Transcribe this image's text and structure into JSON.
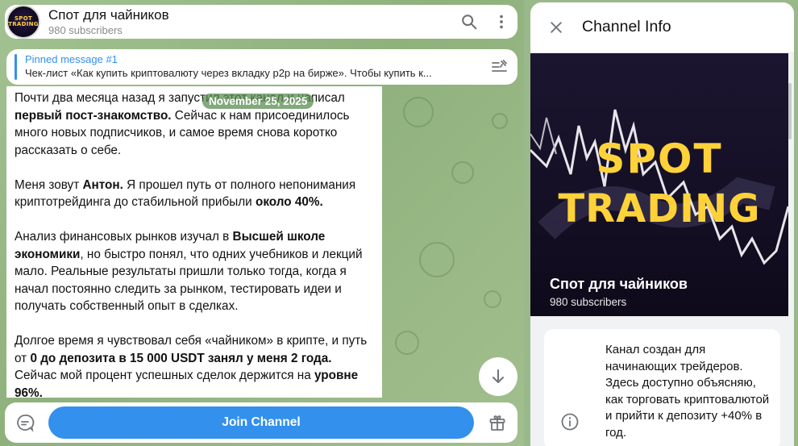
{
  "header": {
    "avatar_text": [
      "SPOT",
      "TRADING"
    ],
    "title": "Спот для чайников",
    "subtitle": "980 subscribers"
  },
  "pinned": {
    "title": "Pinned message #1",
    "text": "Чек-лист «Как купить криптовалюту через вкладку p2p на бирже».  Чтобы купить к..."
  },
  "date_pill": "November 25, 2025",
  "message": {
    "p1": [
      {
        "t": "Почти два месяца назад я запустил этот канал и написал ",
        "b": false
      },
      {
        "t": "первый пост-знакомство.",
        "b": true
      },
      {
        "t": " Сейчас к нам присоединилось много новых подписчиков, и самое время снова коротко рассказать о себе.",
        "b": false
      }
    ],
    "p2": [
      {
        "t": "Меня зовут ",
        "b": false
      },
      {
        "t": "Антон.",
        "b": true
      },
      {
        "t": " Я прошел путь от полного непонимания криптотрейдинга до стабильной прибыли ",
        "b": false
      },
      {
        "t": "около 40%.",
        "b": true
      }
    ],
    "p3": [
      {
        "t": "Анализ финансовых рынков изучал в ",
        "b": false
      },
      {
        "t": "Высшей школе экономики",
        "b": true
      },
      {
        "t": ", но быстро понял, что одних учебников и лекций мало. Реальные результаты пришли только тогда, когда я начал постоянно следить за рынком, тестировать идеи и получать собственный опыт в сделках.",
        "b": false
      }
    ],
    "p4": [
      {
        "t": "Долгое время я чувствовал себя «чайником» в крипте, и путь от ",
        "b": false
      },
      {
        "t": "0 до депозита в 15 000 USDT занял у меня 2 года.",
        "b": true
      },
      {
        "t": " Сейчас мой процент успешных сделок держится на ",
        "b": false
      },
      {
        "t": "уровне 96%.",
        "b": true
      }
    ]
  },
  "bottom": {
    "join_label": "Join Channel"
  },
  "panel": {
    "title": "Channel Info",
    "cover_logo_line1": "SPOT",
    "cover_logo_line2": "TRADING",
    "channel_name": "Спот для чайников",
    "channel_subs": "980 subscribers",
    "description": "Канал создан для начинающих трейдеров. Здесь доступно объясняю, как торговать криптовалютой и прийти к депозиту +40% в год."
  },
  "colors": {
    "accent": "#3390ec",
    "logo_yellow": "#ffd23a",
    "chat_bg": "#9ab98a"
  },
  "icons": [
    "search-icon",
    "more-vertical-icon",
    "pinned-list-icon",
    "arrow-down-icon",
    "emoji-icon",
    "gift-icon",
    "close-icon",
    "info-icon"
  ]
}
